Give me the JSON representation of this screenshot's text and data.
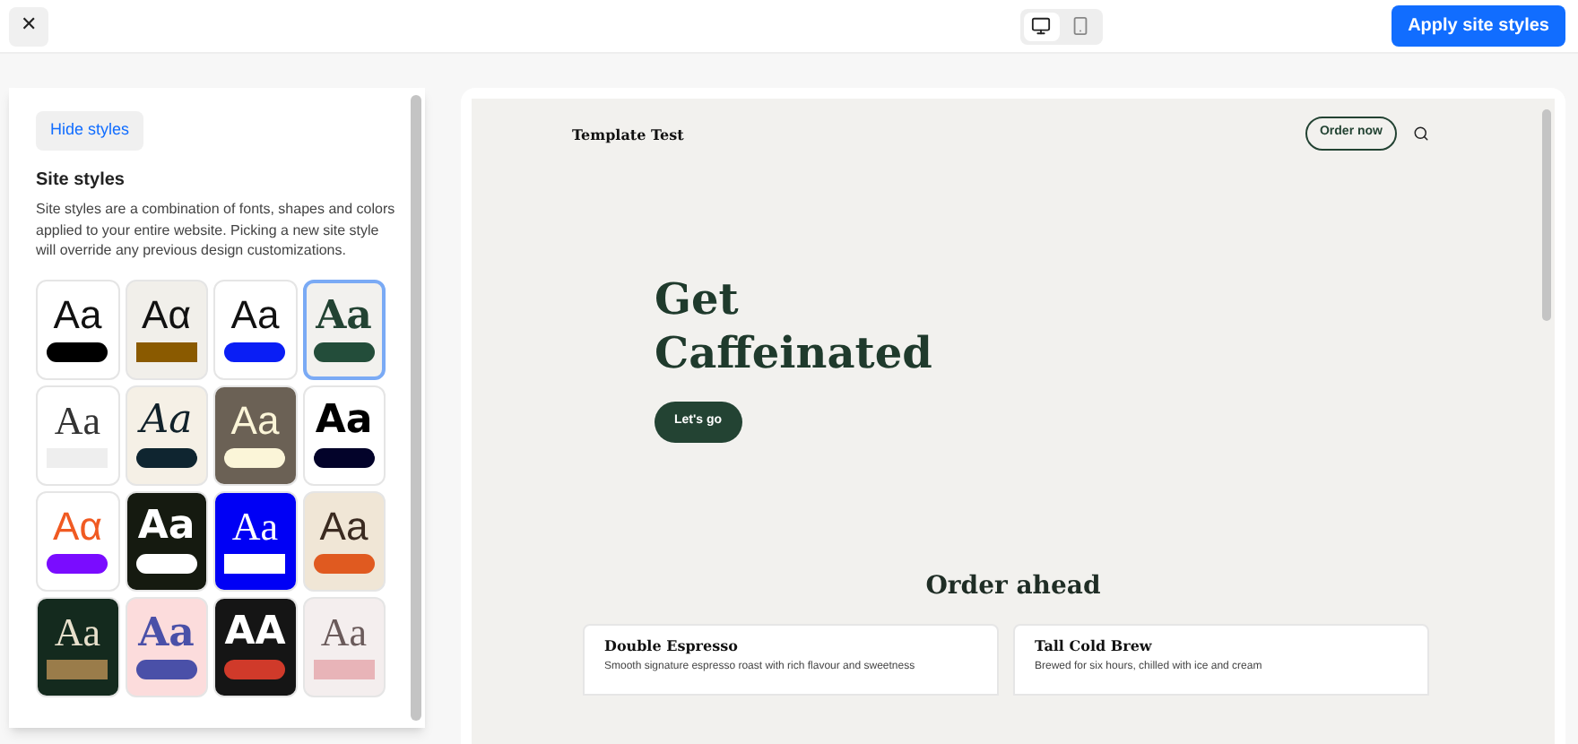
{
  "toolbar": {
    "close": "✕",
    "views": [
      {
        "kind": "desktop",
        "selected": true
      },
      {
        "kind": "mobile",
        "selected": false
      }
    ],
    "apply": "Apply site styles"
  },
  "panel": {
    "hide": "Hide styles",
    "title": "Site styles",
    "description": "Site styles are a combination of fonts, shapes and colors applied to your entire website. Picking a new site style will override any previous design customizations.",
    "styles": [
      {
        "color": "#ffffff",
        "selected": false,
        "sample": {
          "text": "Aa",
          "kind": "sans",
          "color": "#111111"
        },
        "swatch": {
          "kind": "pill",
          "color": "#000000"
        }
      },
      {
        "color": "#f1efea",
        "selected": false,
        "sample": {
          "text": "Aα",
          "kind": "sans",
          "color": "#111111"
        },
        "swatch": {
          "kind": "rect",
          "color": "#8a5a00"
        }
      },
      {
        "color": "#ffffff",
        "selected": false,
        "sample": {
          "text": "Aa",
          "kind": "sans",
          "color": "#111111"
        },
        "swatch": {
          "kind": "pill",
          "color": "#0a1ef5"
        }
      },
      {
        "color": "#f2f1ee",
        "selected": true,
        "sample": {
          "text": "Aa",
          "kind": "serifbold",
          "color": "#234333"
        },
        "swatch": {
          "kind": "pill",
          "color": "#234d3a"
        }
      },
      {
        "color": "#ffffff",
        "selected": false,
        "sample": {
          "text": "Aa",
          "kind": "serif",
          "color": "#333333"
        },
        "swatch": {
          "kind": "rect",
          "color": "#eeeeee"
        }
      },
      {
        "color": "#f5f0e6",
        "selected": false,
        "sample": {
          "text": "Aa",
          "kind": "script",
          "color": "#10212a"
        },
        "swatch": {
          "kind": "pill",
          "color": "#0f2530"
        }
      },
      {
        "color": "#6b6155",
        "selected": false,
        "sample": {
          "text": "Aa",
          "kind": "sans",
          "color": "#fbf5d8"
        },
        "swatch": {
          "kind": "pill",
          "color": "#fbf5d8"
        }
      },
      {
        "color": "#ffffff",
        "selected": false,
        "sample": {
          "text": "Aa",
          "kind": "black",
          "color": "#000000"
        },
        "swatch": {
          "kind": "pill",
          "color": "#03032a"
        }
      },
      {
        "color": "#ffffff",
        "selected": false,
        "sample": {
          "text": "Aα",
          "kind": "sans",
          "color": "#f05a22"
        },
        "swatch": {
          "kind": "pill",
          "color": "#7a0cff"
        }
      },
      {
        "color": "#151a10",
        "selected": false,
        "sample": {
          "text": "Aa",
          "kind": "black",
          "color": "#ffffff"
        },
        "swatch": {
          "kind": "pill",
          "color": "#ffffff"
        }
      },
      {
        "color": "#0000f5",
        "selected": false,
        "sample": {
          "text": "Aa",
          "kind": "serif",
          "color": "#ffffff"
        },
        "swatch": {
          "kind": "rect",
          "color": "#ffffff"
        }
      },
      {
        "color": "#f0e6d6",
        "selected": false,
        "sample": {
          "text": "Aa",
          "kind": "sans",
          "color": "#3a2a20"
        },
        "swatch": {
          "kind": "pill",
          "color": "#e05a20"
        }
      },
      {
        "color": "#142a1e",
        "selected": false,
        "sample": {
          "text": "Aa",
          "kind": "serif",
          "color": "#e8e0cc"
        },
        "swatch": {
          "kind": "rect",
          "color": "#9a7c4a"
        }
      },
      {
        "color": "#fcdcdc",
        "selected": false,
        "sample": {
          "text": "Aa",
          "kind": "serifbold",
          "color": "#4a50a8"
        },
        "swatch": {
          "kind": "pill",
          "color": "#4a50a8"
        }
      },
      {
        "color": "#151515",
        "selected": false,
        "sample": {
          "text": "AA",
          "kind": "black",
          "color": "#ffffff"
        },
        "swatch": {
          "kind": "pill",
          "color": "#d03a2a"
        }
      },
      {
        "color": "#f4eeee",
        "selected": false,
        "sample": {
          "text": "Aa",
          "kind": "serif",
          "color": "#6a5a5a"
        },
        "swatch": {
          "kind": "rect",
          "color": "#e8b4b8"
        }
      }
    ]
  },
  "preview": {
    "brand": "Template Test",
    "order_button": "Order now",
    "hero_title": "Get Caffeinated",
    "hero_button": "Let's go",
    "section_title": "Order ahead",
    "products": [
      {
        "name": "Double Espresso",
        "description": "Smooth signature espresso roast with rich flavour and sweetness"
      },
      {
        "name": "Tall Cold Brew",
        "description": "Brewed for six hours, chilled with ice and cream"
      }
    ]
  }
}
